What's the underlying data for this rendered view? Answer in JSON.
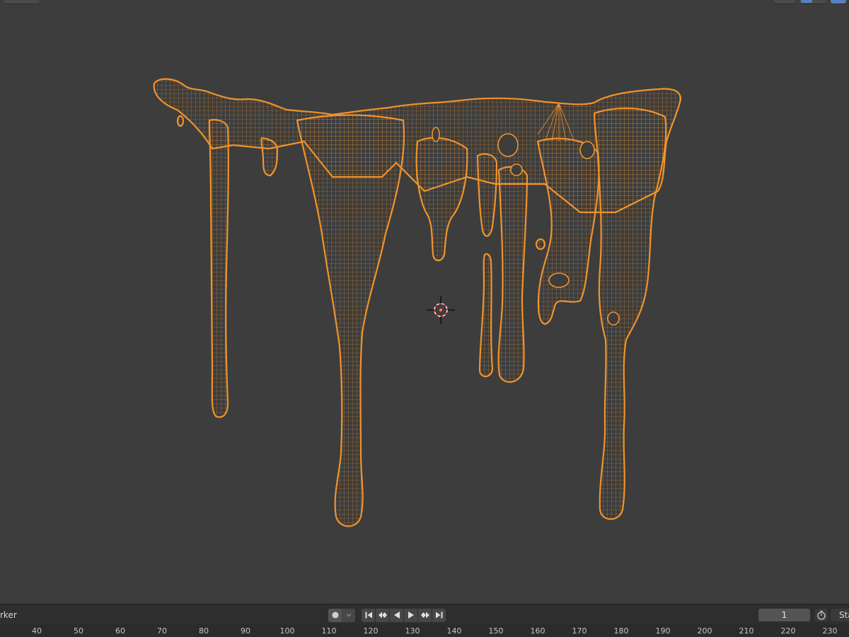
{
  "viewport": {
    "object_color": "#f0932b",
    "background": "#3d3d3d",
    "cursor_icon": "3d-cursor-icon"
  },
  "timeline": {
    "marker_menu": "rker",
    "current_frame": "1",
    "start_label": "Sta",
    "transport": {
      "record": "record-icon",
      "keying": "chevron-down-icon",
      "jump_start": "jump-start-icon",
      "prev_keyframe": "prev-keyframe-icon",
      "play_reverse": "play-reverse-icon",
      "play": "play-icon",
      "next_keyframe": "next-keyframe-icon",
      "jump_end": "jump-end-icon"
    },
    "ruler_ticks": [
      "40",
      "50",
      "60",
      "70",
      "80",
      "90",
      "100",
      "110",
      "120",
      "130",
      "140",
      "150",
      "160",
      "170",
      "180",
      "190",
      "200",
      "210",
      "220",
      "230"
    ]
  }
}
